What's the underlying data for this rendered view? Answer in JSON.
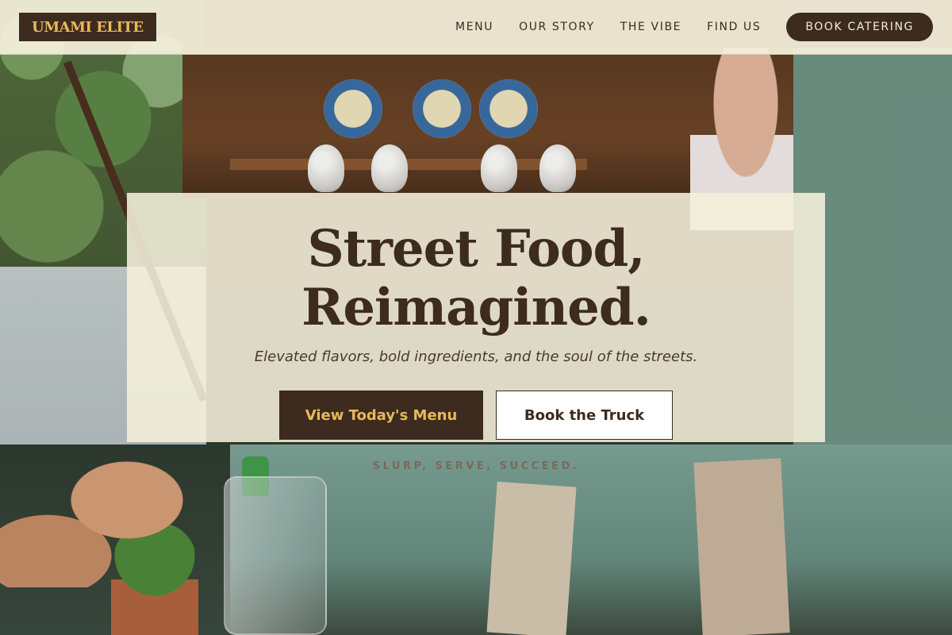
{
  "header": {
    "logo": "UMAMI ELITE",
    "nav": [
      {
        "label": "MENU"
      },
      {
        "label": "OUR STORY"
      },
      {
        "label": "THE VIBE"
      },
      {
        "label": "FIND US"
      }
    ],
    "cta": "BOOK CATERING"
  },
  "hero": {
    "title": "Street Food, Reimagined.",
    "subtitle": "Elevated flavors, bold ingredients, and the soul of the streets.",
    "primary_button": "View Today's Menu",
    "secondary_button": "Book the Truck",
    "tagline": "SLURP, SERVE, SUCCEED."
  },
  "colors": {
    "brand_dark": "#3d2b1f",
    "brand_gold": "#e7b95a",
    "cream_panel": "#f5f0dc"
  }
}
